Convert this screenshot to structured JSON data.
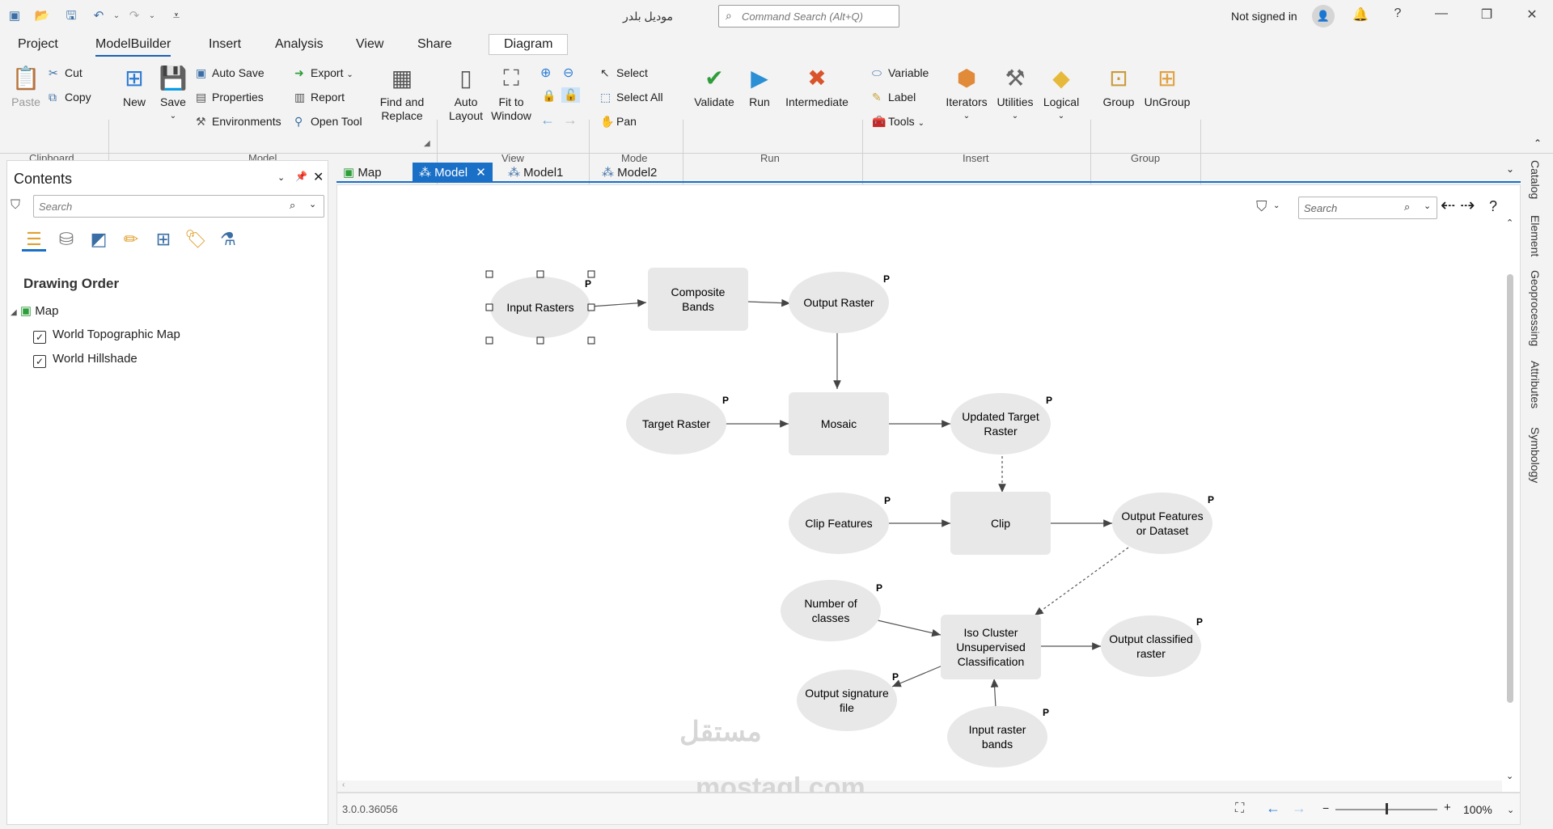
{
  "title_bar": {
    "document_title": "موديل بلدر",
    "command_search_placeholder": "Command Search (Alt+Q)",
    "account": "Not signed in"
  },
  "menu_tabs": [
    "Project",
    "ModelBuilder",
    "Insert",
    "Analysis",
    "View",
    "Share",
    "Diagram"
  ],
  "ribbon": {
    "clipboard": {
      "group": "Clipboard",
      "paste": "Paste",
      "cut": "Cut",
      "copy": "Copy"
    },
    "model": {
      "group": "Model",
      "new": "New",
      "save": "Save",
      "auto_save": "Auto Save",
      "properties": "Properties",
      "environments": "Environments",
      "export": "Export",
      "report": "Report",
      "open_tool": "Open Tool",
      "find_replace_1": "Find and",
      "find_replace_2": "Replace"
    },
    "view": {
      "group": "View",
      "auto_layout_1": "Auto",
      "auto_layout_2": "Layout",
      "fit_1": "Fit to",
      "fit_2": "Window"
    },
    "mode": {
      "group": "Mode",
      "select": "Select",
      "select_all": "Select All",
      "pan": "Pan"
    },
    "run": {
      "group": "Run",
      "validate": "Validate",
      "run": "Run",
      "intermediate": "Intermediate"
    },
    "insert": {
      "group": "Insert",
      "variable": "Variable",
      "label": "Label",
      "tools": "Tools",
      "iterators": "Iterators",
      "utilities": "Utilities",
      "logical": "Logical"
    },
    "group_grp": {
      "group": "Group",
      "ungroup": "UnGroup"
    }
  },
  "contents": {
    "title": "Contents",
    "search_placeholder": "Search",
    "drawing_order": "Drawing Order",
    "map": "Map",
    "layers": [
      "World Topographic Map",
      "World Hillshade"
    ]
  },
  "view_tabs": [
    "Map",
    "Model",
    "Model1",
    "Model2"
  ],
  "canvas": {
    "search_placeholder": "Search",
    "help": "?"
  },
  "model_nodes": {
    "input_rasters": "Input Rasters",
    "composite_bands_1": "Composite",
    "composite_bands_2": "Bands",
    "output_raster": "Output Raster",
    "target_raster": "Target Raster",
    "mosaic": "Mosaic",
    "updated_target_1": "Updated Target",
    "updated_target_2": "Raster",
    "clip_features": "Clip Features",
    "clip": "Clip",
    "output_features_1": "Output Features",
    "output_features_2": "or Dataset",
    "num_classes_1": "Number of",
    "num_classes_2": "classes",
    "iso_1": "Iso Cluster",
    "iso_2": "Unsupervised",
    "iso_3": "Classification",
    "output_classified_1": "Output classified",
    "output_classified_2": "raster",
    "output_sig_1": "Output signature",
    "output_sig_2": "file",
    "input_bands_1": "Input raster",
    "input_bands_2": "bands",
    "param_marker": "P"
  },
  "right_rail": [
    "Catalog",
    "Element",
    "Geoprocessing",
    "Attributes",
    "Symbology"
  ],
  "status_bar": {
    "version": "3.0.0.36056",
    "zoom": "100%"
  },
  "watermark": {
    "arabic": "مستقل",
    "latin": "mostaql.com"
  },
  "colors": {
    "accent": "#1a6fc7",
    "node_fill": "#e8e8e8",
    "validate": "#2e9d3a",
    "intermediate": "#d9542b"
  }
}
